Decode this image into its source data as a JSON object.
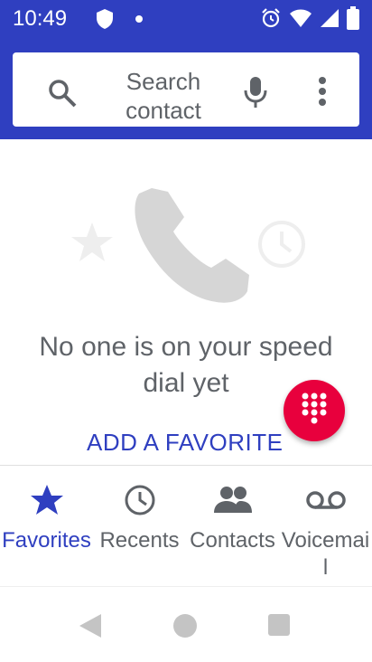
{
  "status_bar": {
    "time": "10:49"
  },
  "search": {
    "placeholder": "Search contact"
  },
  "empty_state": {
    "message": "No one is on your speed dial yet",
    "action": "ADD A FAVORITE"
  },
  "tabs": [
    {
      "label": "Favorites",
      "icon": "star-icon",
      "active": true
    },
    {
      "label": "Recents",
      "icon": "clock-icon",
      "active": false
    },
    {
      "label": "Contacts",
      "icon": "people-icon",
      "active": false
    },
    {
      "label": "Voicemail",
      "icon": "voicemail-icon",
      "active": false
    }
  ],
  "colors": {
    "primary": "#2f3fc0",
    "fab": "#e8003d",
    "text_secondary": "#5f6368"
  }
}
